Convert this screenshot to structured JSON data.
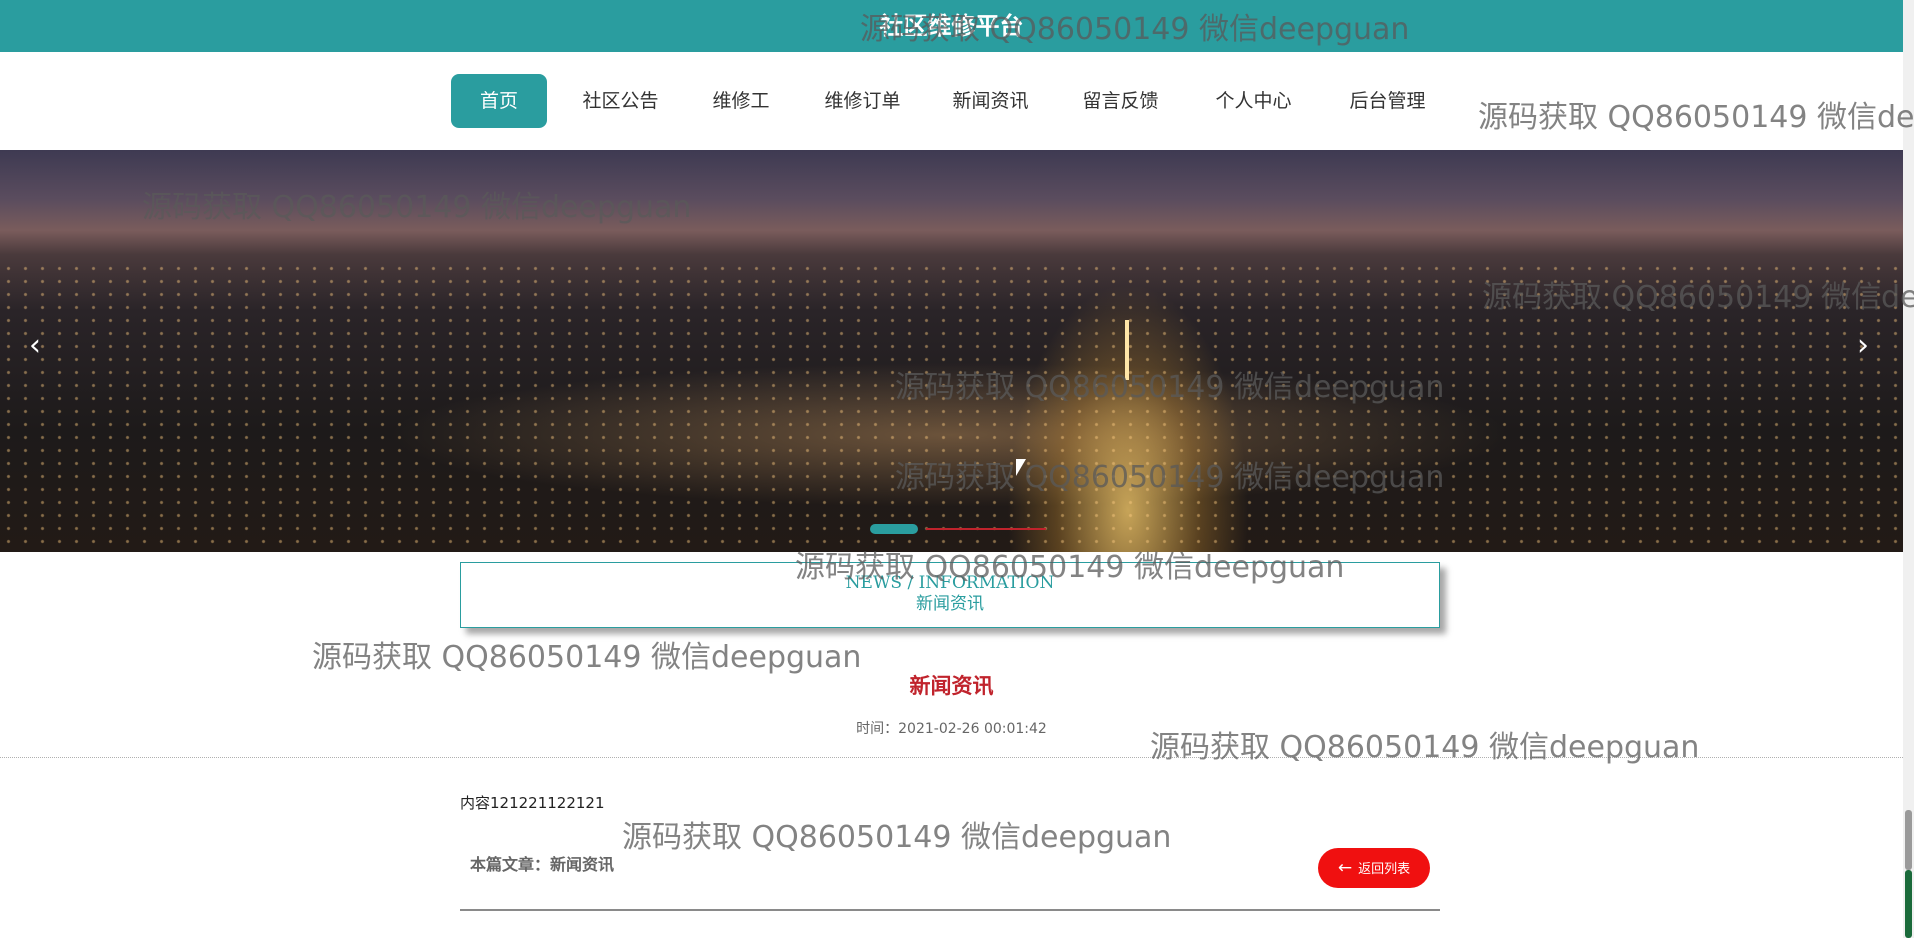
{
  "header": {
    "title": "社区维修平台"
  },
  "nav": {
    "items": [
      {
        "label": "首页",
        "active": true
      },
      {
        "label": "社区公告",
        "active": false
      },
      {
        "label": "维修工",
        "active": false
      },
      {
        "label": "维修订单",
        "active": false
      },
      {
        "label": "新闻资讯",
        "active": false
      },
      {
        "label": "留言反馈",
        "active": false
      },
      {
        "label": "个人中心",
        "active": false
      },
      {
        "label": "后台管理",
        "active": false
      }
    ]
  },
  "carousel": {
    "prev_icon": "chevron-left-icon",
    "next_icon": "chevron-right-icon",
    "prev_glyph": "‹",
    "next_glyph": "›"
  },
  "section": {
    "title_en": "NEWS / INFORMATION",
    "title_cn": "新闻资讯"
  },
  "article": {
    "title": "新闻资讯",
    "time": "时间：2021-02-26 00:01:42",
    "content": "内容121221122121",
    "category": "本篇文章：新闻资讯",
    "back_label": "返回列表",
    "back_glyph": "←"
  },
  "watermark": {
    "text": "源码获取 QQ86050149 微信deepguan"
  },
  "colors": {
    "accent": "#2a9d9f",
    "title_red": "#c0232c",
    "button_red": "#f01010"
  }
}
